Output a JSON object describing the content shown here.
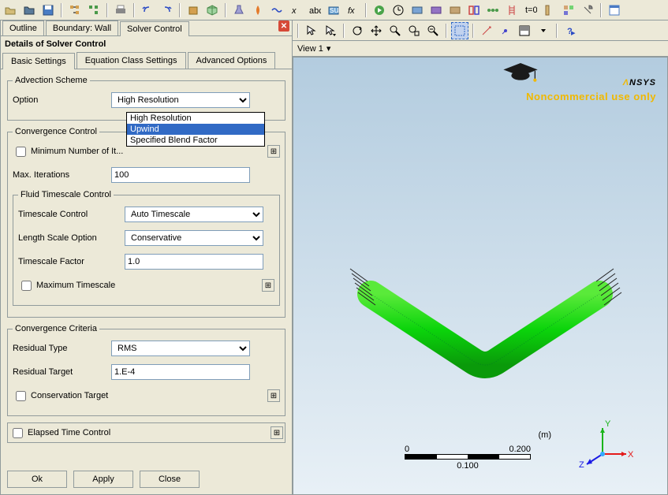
{
  "tabs": {
    "outline": "Outline",
    "boundary": "Boundary: Wall",
    "solver": "Solver Control"
  },
  "details_title": "Details of Solver Control",
  "subtabs": {
    "basic": "Basic Settings",
    "eqclass": "Equation Class Settings",
    "advanced": "Advanced Options"
  },
  "advection": {
    "legend": "Advection Scheme",
    "option_label": "Option",
    "option_value": "High Resolution",
    "dropdown": [
      "High Resolution",
      "Upwind",
      "Specified Blend Factor"
    ],
    "selected_index": 1
  },
  "convergence_control": {
    "legend": "Convergence Control",
    "min_iter_label": "Minimum Number of It...",
    "max_iter_label": "Max. Iterations",
    "max_iter_value": "100"
  },
  "fluid_ts": {
    "legend": "Fluid Timescale Control",
    "ts_control_label": "Timescale Control",
    "ts_control_value": "Auto Timescale",
    "length_scale_label": "Length Scale Option",
    "length_scale_value": "Conservative",
    "ts_factor_label": "Timescale Factor",
    "ts_factor_value": "1.0",
    "max_ts_label": "Maximum Timescale"
  },
  "convergence_criteria": {
    "legend": "Convergence Criteria",
    "res_type_label": "Residual Type",
    "res_type_value": "RMS",
    "res_target_label": "Residual Target",
    "res_target_value": "1.E-4",
    "cons_target_label": "Conservation Target"
  },
  "elapsed_label": "Elapsed Time Control",
  "buttons": {
    "ok": "Ok",
    "apply": "Apply",
    "close": "Close"
  },
  "view": {
    "title": "View 1"
  },
  "ansys": {
    "brand": "ANSYS",
    "tag": "Noncommercial use only"
  },
  "scale": {
    "v0": "0",
    "v1": "0.100",
    "v2": "0.200",
    "unit": "(m)"
  },
  "triad": {
    "x": "X",
    "y": "Y",
    "z": "Z"
  }
}
